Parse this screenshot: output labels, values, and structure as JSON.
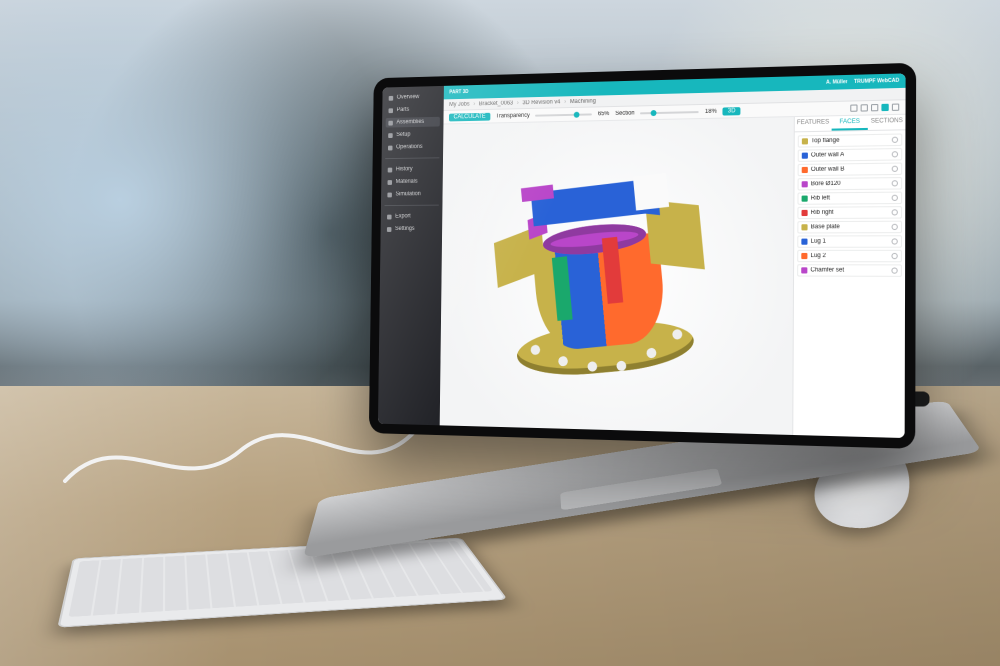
{
  "app": {
    "brand": "TRUMPF WebCAD",
    "title_left": "PART 3D",
    "user": "A. Müller"
  },
  "breadcrumb": [
    "My Jobs",
    "Bracket_0063",
    "3D Revision v4",
    "Machining"
  ],
  "sidebar": {
    "items": [
      {
        "icon": "home",
        "label": "Overview"
      },
      {
        "icon": "cube",
        "label": "Parts"
      },
      {
        "icon": "layers",
        "label": "Assemblies"
      },
      {
        "icon": "gear",
        "label": "Setup"
      },
      {
        "icon": "list",
        "label": "Operations"
      },
      {
        "icon": "clock",
        "label": "History"
      },
      {
        "icon": "tag",
        "label": "Materials"
      },
      {
        "icon": "bolt",
        "label": "Simulation"
      },
      {
        "icon": "download",
        "label": "Export"
      },
      {
        "icon": "gear2",
        "label": "Settings"
      }
    ],
    "active_index": 2
  },
  "toolbar": {
    "primary_chip": "CALCULATE",
    "slider1": {
      "label": "Transparency",
      "value": "65%"
    },
    "slider2": {
      "label": "Section",
      "value": "18%"
    },
    "toggle_value": "3D"
  },
  "rightpanel": {
    "tabs": [
      "FEATURES",
      "FACES",
      "SECTIONS"
    ],
    "active_tab": 1,
    "rows": [
      {
        "color": "#c7b24a",
        "name": "Top flange"
      },
      {
        "color": "#2962d7",
        "name": "Outer wall A"
      },
      {
        "color": "#ff6a2d",
        "name": "Outer wall B"
      },
      {
        "color": "#b946c9",
        "name": "Bore Ø120"
      },
      {
        "color": "#1aa86c",
        "name": "Rib left"
      },
      {
        "color": "#e23b3b",
        "name": "Rib right"
      },
      {
        "color": "#c7b24a",
        "name": "Base plate"
      },
      {
        "color": "#2962d7",
        "name": "Lug 1"
      },
      {
        "color": "#ff6a2d",
        "name": "Lug 2"
      },
      {
        "color": "#b946c9",
        "name": "Chamfer set"
      }
    ]
  },
  "viewport": {
    "part_name": "Bracket_0063",
    "colors": {
      "yellow": "#c7b24a",
      "blue": "#2962d7",
      "orange": "#ff6a2d",
      "magenta": "#b946c9",
      "green": "#1aa86c",
      "red": "#e23b3b"
    }
  }
}
